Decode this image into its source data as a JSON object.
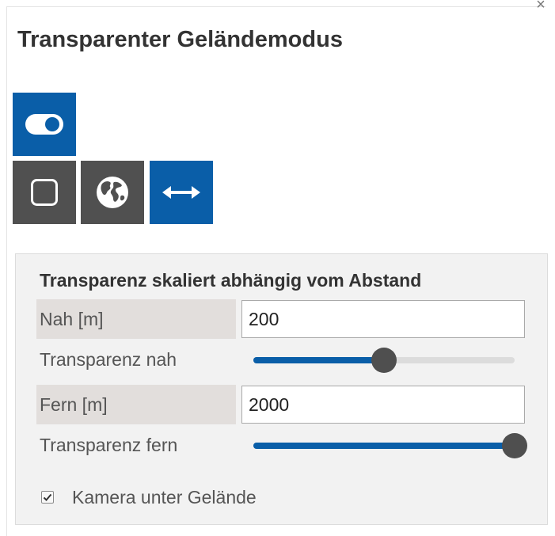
{
  "panel": {
    "title": "Transparenter Geländemodus",
    "close_glyph": "×"
  },
  "mode_toggle": {
    "icon": "toggle-switch-icon",
    "state": "on"
  },
  "mode_buttons": [
    {
      "icon": "square-outline-icon",
      "active": false
    },
    {
      "icon": "globe-icon",
      "active": false
    },
    {
      "icon": "left-right-arrow-icon",
      "active": true
    }
  ],
  "settings": {
    "heading": "Transparenz skaliert abhängig vom Abstand",
    "near_label": "Nah [m]",
    "near_value": "200",
    "near_transparency_label": "Transparenz nah",
    "near_transparency": 0.5,
    "far_label": "Fern [m]",
    "far_value": "2000",
    "far_transparency_label": "Transparenz fern",
    "far_transparency": 1.0,
    "camera_below_label": "Kamera unter Gelände",
    "camera_below_checked": true
  },
  "colors": {
    "accent": "#0a5ea8",
    "tile_inactive": "#505050",
    "thumb": "#4f4f4f"
  }
}
